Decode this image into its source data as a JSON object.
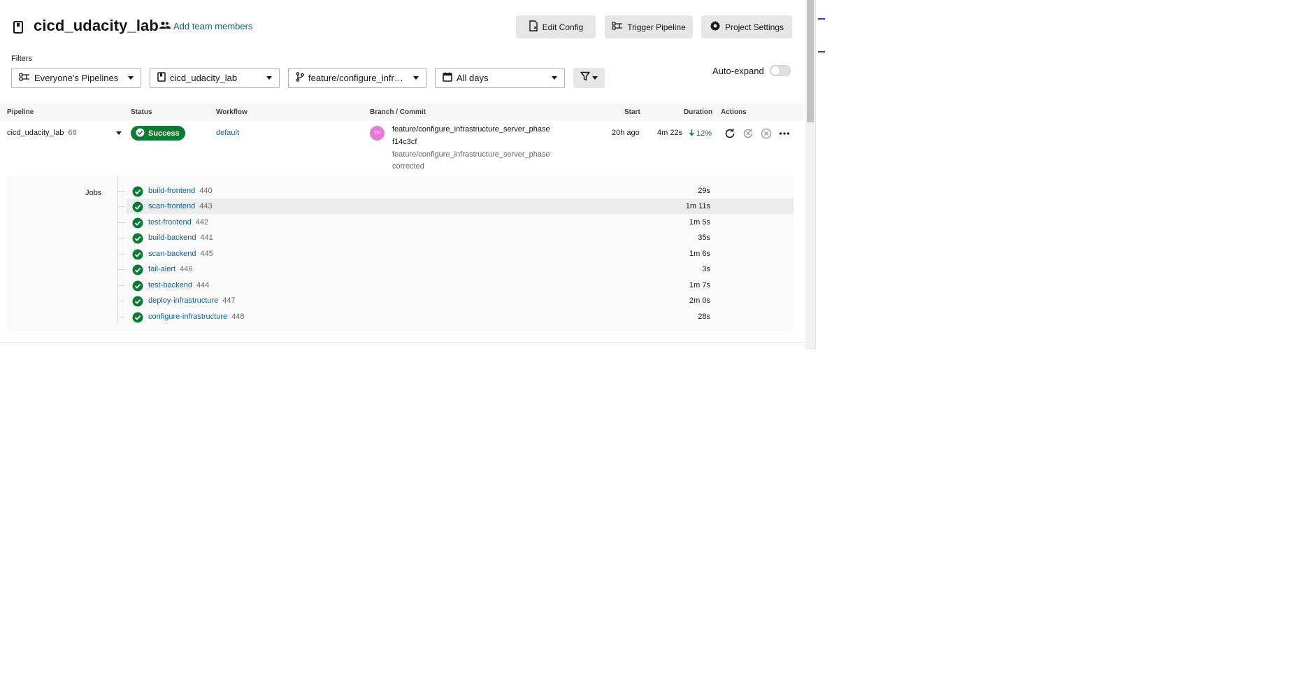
{
  "header": {
    "project_title": "cicd_udacity_lab",
    "add_team_label": "Add team members",
    "buttons": {
      "edit_config": "Edit Config",
      "trigger_pipeline": "Trigger Pipeline",
      "project_settings": "Project Settings"
    }
  },
  "filters": {
    "label": "Filters",
    "pipelines_owner": "Everyone's Pipelines",
    "project": "cicd_udacity_lab",
    "branch": "feature/configure_infr…",
    "date_range": "All days",
    "auto_expand_label": "Auto-expand",
    "auto_expand_on": false
  },
  "table": {
    "columns": {
      "pipeline": "Pipeline",
      "status": "Status",
      "workflow": "Workflow",
      "branch_commit": "Branch / Commit",
      "start": "Start",
      "duration": "Duration",
      "actions": "Actions"
    },
    "pipeline": {
      "name": "cicd_udacity_lab",
      "number": "68",
      "status": "Success",
      "status_color": "#0a7c32",
      "workflow": "default",
      "avatar_initials": "TH",
      "branch": "feature/configure_infrastructure_server_phase",
      "commit": "f14c3cf",
      "commit_message_line1": "feature/configure_infrastructure_server_phase",
      "commit_message_line2": "corrected",
      "start": "20h ago",
      "duration": "4m 22s",
      "duration_change": "12%"
    },
    "jobs_label": "Jobs",
    "jobs": [
      {
        "name": "build-frontend",
        "number": "440",
        "duration": "29s"
      },
      {
        "name": "scan-frontend",
        "number": "443",
        "duration": "1m 11s"
      },
      {
        "name": "test-frontend",
        "number": "442",
        "duration": "1m 5s"
      },
      {
        "name": "build-backend",
        "number": "441",
        "duration": "35s"
      },
      {
        "name": "scan-backend",
        "number": "445",
        "duration": "1m 6s"
      },
      {
        "name": "fail-alert",
        "number": "446",
        "duration": "3s"
      },
      {
        "name": "test-backend",
        "number": "444",
        "duration": "1m 7s"
      },
      {
        "name": "deploy-infrastructure",
        "number": "447",
        "duration": "2m 0s"
      },
      {
        "name": "configure-infrastructure",
        "number": "448",
        "duration": "28s"
      }
    ]
  },
  "colors": {
    "link": "#0f5f9c",
    "success": "#0a7c32",
    "button_bg": "#e6e6e6"
  }
}
